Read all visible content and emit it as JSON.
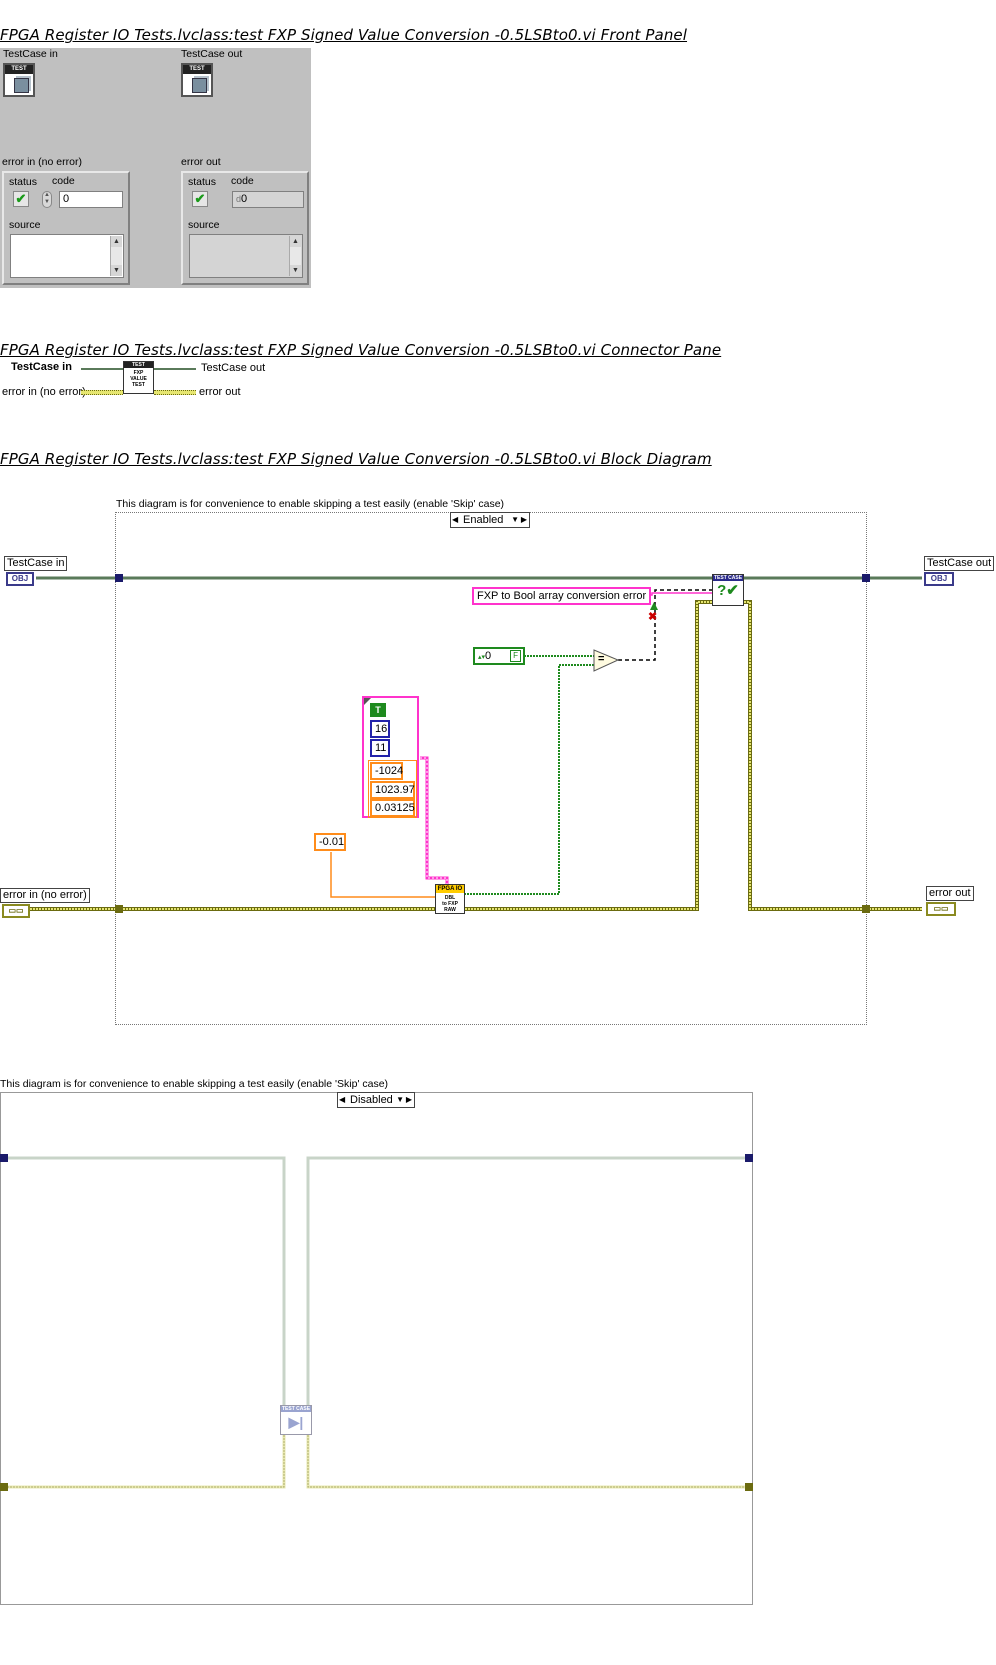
{
  "headings": {
    "front_panel": "FPGA Register IO Tests.lvclass:test  FXP Signed Value Conversion  -0.5LSBto0.vi Front Panel",
    "connector_pane": "FPGA Register IO Tests.lvclass:test  FXP Signed Value Conversion  -0.5LSBto0.vi Connector Pane",
    "block_diagram": "FPGA Register IO Tests.lvclass:test  FXP Signed Value Conversion  -0.5LSBto0.vi Block Diagram"
  },
  "front_panel": {
    "testcase_in_label": "TestCase in",
    "testcase_out_label": "TestCase out",
    "class_icon_text": "TEST",
    "error_in": {
      "label": "error in (no error)",
      "status_label": "status",
      "code_label": "code",
      "code_value": "0",
      "source_label": "source",
      "status_mark": "✔"
    },
    "error_out": {
      "label": "error out",
      "status_label": "status",
      "code_label": "code",
      "code_value": "0",
      "code_prefix": "d",
      "source_label": "source",
      "status_mark": "✔"
    }
  },
  "connector_pane": {
    "testcase_in": "TestCase in",
    "testcase_out": "TestCase out",
    "error_in": "error in (no error)",
    "error_out": "error out",
    "icon_lines": [
      "TEST",
      "FXP",
      "VALUE",
      "TEST"
    ]
  },
  "diagram1": {
    "comment": "This diagram is for convenience to enable skipping a test easily (enable 'Skip' case)",
    "case_selector": "Enabled",
    "testcase_in": "TestCase in",
    "testcase_out": "TestCase out",
    "error_in": "error in (no error)",
    "error_out": "error out",
    "obj_text": "OBJ",
    "error_message": "FXP to Bool array conversion error",
    "bool_const_value": "0",
    "bool_const_flag": "F",
    "cluster_bool": "T",
    "word_length": "16",
    "integer_word_length": "11",
    "minimum": "-1024",
    "maximum": "1023.97",
    "delta": "0.03125",
    "input_value": "-0.01",
    "fpga_vi_lines": [
      "FPGA IO",
      "DBL",
      "to FXP",
      "RAW"
    ],
    "check_vi_top": "TEST CASE",
    "check_vi_mark": "?✔",
    "equal_symbol": "="
  },
  "diagram2": {
    "comment": "This diagram is for convenience to enable skipping a test easily (enable 'Skip' case)",
    "case_selector": "Disabled",
    "skip_vi_top": "TEST CASE"
  },
  "colors": {
    "class_wire": "#5a7a5a",
    "error_wire": "#c8c840",
    "string_wire": "#ff33cc",
    "bool_wire": "#1e8a1e",
    "dbl_wire": "#ff8c1a"
  }
}
